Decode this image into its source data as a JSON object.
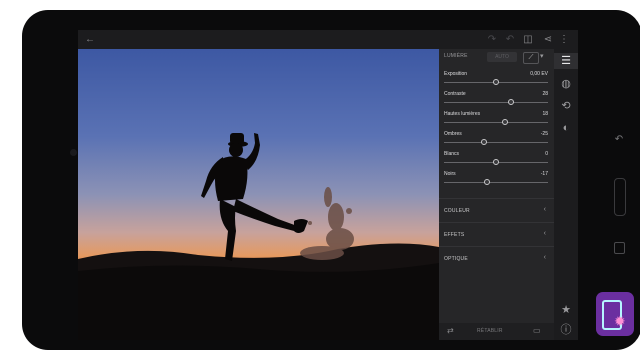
{
  "topbar": {
    "back_icon": "arrow-left-icon",
    "redo_icon": "redo-icon",
    "undo_icon": "undo-icon",
    "compare_icon": "compare-icon",
    "share_icon": "share-icon",
    "more_icon": "more-vert-icon"
  },
  "panel": {
    "section_title": "LUMIÈRE",
    "auto_label": "AUTO",
    "sliders": [
      {
        "label": "Exposition",
        "value": "0,00 EV",
        "level": 0.5
      },
      {
        "label": "Contraste",
        "value": "28",
        "level": 0.64
      },
      {
        "label": "Hautes lumières",
        "value": "18",
        "level": 0.59
      },
      {
        "label": "Ombres",
        "value": "-25",
        "level": 0.38
      },
      {
        "label": "Blancs",
        "value": "0",
        "level": 0.5
      },
      {
        "label": "Noirs",
        "value": "-17",
        "level": 0.41
      }
    ],
    "sections": [
      {
        "label": "COULEUR"
      },
      {
        "label": "EFFETS"
      },
      {
        "label": "OPTIQUE"
      }
    ],
    "reset_label": "RÉTABLIR"
  },
  "side_tools": [
    "sliders-icon",
    "circle-icon",
    "crop-rotate-icon",
    "filter-icon",
    "star-icon",
    "info-icon"
  ],
  "colors": {
    "panel_bg": "#262628",
    "accent": "#ffffff"
  }
}
